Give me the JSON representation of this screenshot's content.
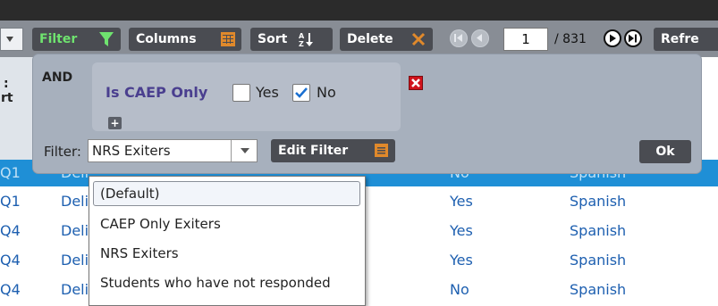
{
  "toolbar": {
    "filter_label": "Filter",
    "columns_label": "Columns",
    "sort_label": "Sort",
    "delete_label": "Delete",
    "page_value": "1",
    "page_total": "/ 831",
    "refresh_label": "Refre",
    "colors": {
      "filter_text": "#6fe36f",
      "columns_icon": "#e0892b",
      "delete_icon": "#e0892b"
    },
    "icons": [
      "dropdown-arrow-icon",
      "funnel-icon",
      "columns-grid-icon",
      "sort-az-icon",
      "delete-x-icon",
      "first-page-icon",
      "prev-page-icon",
      "next-page-icon",
      "last-page-icon"
    ]
  },
  "grid": {
    "header_fragments": [
      ":",
      "rt"
    ],
    "rows": [
      {
        "c1": "Q1",
        "c2": "Deli",
        "c3": "No",
        "c4": "Spanish",
        "highlighted": true
      },
      {
        "c1": "Q1",
        "c2": "Deli",
        "c3": "Yes",
        "c4": "Spanish",
        "highlighted": false
      },
      {
        "c1": "Q4",
        "c2": "Deli",
        "c3": "Yes",
        "c4": "Spanish",
        "highlighted": false
      },
      {
        "c1": "Q4",
        "c2": "Deli",
        "c3": "Yes",
        "c4": "Spanish",
        "highlighted": false
      },
      {
        "c1": "Q4",
        "c2": "Deli",
        "c3": "No",
        "c4": "Spanish",
        "highlighted": false
      }
    ]
  },
  "filter_panel": {
    "operator": "AND",
    "condition": {
      "field": "Is CAEP Only",
      "yes_label": "Yes",
      "no_label": "No",
      "yes_checked": false,
      "no_checked": true
    },
    "add_label": "+",
    "filter_label": "Filter:",
    "selected_filter": "NRS Exiters",
    "edit_filter_label": "Edit Filter",
    "ok_label": "Ok",
    "dropdown_options": [
      "(Default)",
      "CAEP Only Exiters",
      "NRS Exiters",
      "Students who have not responded"
    ]
  }
}
